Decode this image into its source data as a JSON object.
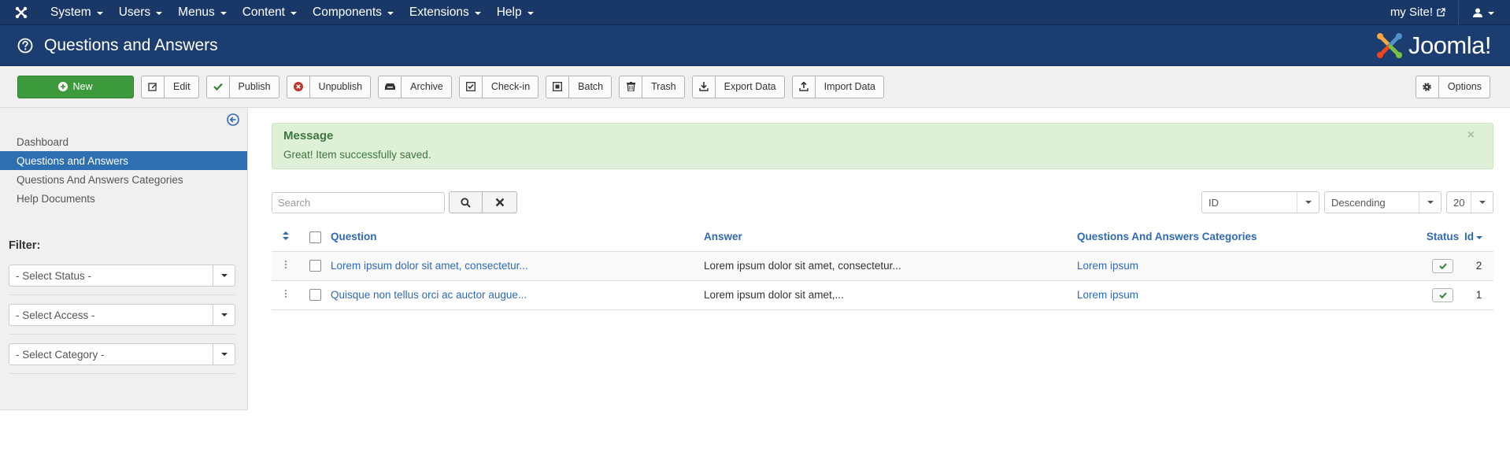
{
  "topnav": {
    "menus": [
      "System",
      "Users",
      "Menus",
      "Content",
      "Components",
      "Extensions",
      "Help"
    ],
    "site_link": "my Site!"
  },
  "header": {
    "title": "Questions and Answers",
    "brand": "Joomla!"
  },
  "toolbar": {
    "new": "New",
    "edit": "Edit",
    "publish": "Publish",
    "unpublish": "Unpublish",
    "archive": "Archive",
    "checkin": "Check-in",
    "batch": "Batch",
    "trash": "Trash",
    "export": "Export Data",
    "import": "Import Data",
    "options": "Options"
  },
  "sidebar": {
    "items": [
      "Dashboard",
      "Questions and Answers",
      "Questions And Answers Categories",
      "Help Documents"
    ],
    "active_index": 1,
    "filter_title": "Filter:",
    "filters": [
      "- Select Status -",
      "- Select Access -",
      "- Select Category -"
    ]
  },
  "alert": {
    "heading": "Message",
    "text": "Great! Item successfully saved.",
    "close": "×"
  },
  "search": {
    "placeholder": "Search",
    "sort_field": "ID",
    "sort_direction": "Descending",
    "limit": "20"
  },
  "table": {
    "columns": {
      "question": "Question",
      "answer": "Answer",
      "category": "Questions And Answers Categories",
      "status": "Status",
      "id": "Id"
    },
    "rows": [
      {
        "question": "Lorem ipsum dolor sit amet, consectetur...",
        "answer": "Lorem ipsum dolor sit amet, consectetur...",
        "category": "Lorem ipsum",
        "published": true,
        "id": "2"
      },
      {
        "question": "Quisque non tellus orci ac auctor augue...",
        "answer": "Lorem ipsum dolor sit amet,...",
        "category": "Lorem ipsum",
        "published": true,
        "id": "1"
      }
    ]
  },
  "colors": {
    "navbar": "#1a3867",
    "header": "#1c3d6f",
    "new_button": "#3c9a3c",
    "active_nav": "#2d6fb0",
    "link": "#2f69b5",
    "alert_bg": "#dff0d8"
  }
}
